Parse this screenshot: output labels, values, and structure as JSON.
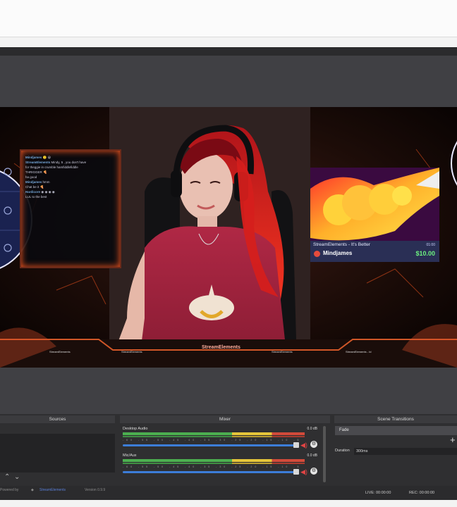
{
  "chat": {
    "lines": [
      {
        "user": "Mindjames",
        "text": "🙂 😀"
      },
      {
        "user": "StreamElements",
        "text": "Mindy, 5 , you don't have"
      },
      {
        "user": "",
        "text": "for theggie in crumble hamfiddlefiddle"
      },
      {
        "user": "",
        "text": "THRIGGER 🍕"
      },
      {
        "user": "",
        "text": "ha good"
      },
      {
        "user": "Mindjames",
        "text": "hmm"
      },
      {
        "user": "",
        "text": "Chat be it 🍕"
      },
      {
        "user": "Hardicore",
        "text": "◉ ◉ ◉ ◉"
      },
      {
        "user": "",
        "text": "LUL to the best"
      }
    ]
  },
  "tip": {
    "title": "StreamElements - It's Better",
    "time": "01:00",
    "name": "Mindjames",
    "amount": "$10.00"
  },
  "overlay": {
    "brand": "StreamElements",
    "chips": [
      "StreamElements",
      "StreamElements",
      "StreamElements",
      "StreamElements - Id"
    ]
  },
  "docks": {
    "sources": "Sources",
    "mixer": "Mixer",
    "transitions": "Scene Transitions"
  },
  "mixer": {
    "channels": [
      {
        "name": "Desktop Audio",
        "db": "0.0 dB"
      },
      {
        "name": "Mic/Aux",
        "db": "0.0 dB"
      }
    ],
    "ticks": "-60 -55 -50 -45 -40 -35 -30 -25 -20 -15 -10 -5 0"
  },
  "transitions": {
    "selected": "Fade",
    "duration_label": "Duration",
    "duration_value": "300ms"
  },
  "status": {
    "live": "LIVE: 00:00:00",
    "rec": "REC: 00:00:00",
    "credit_left": "Powered by",
    "credit_brand": "StreamElements",
    "version": "Version 0.9.9"
  }
}
